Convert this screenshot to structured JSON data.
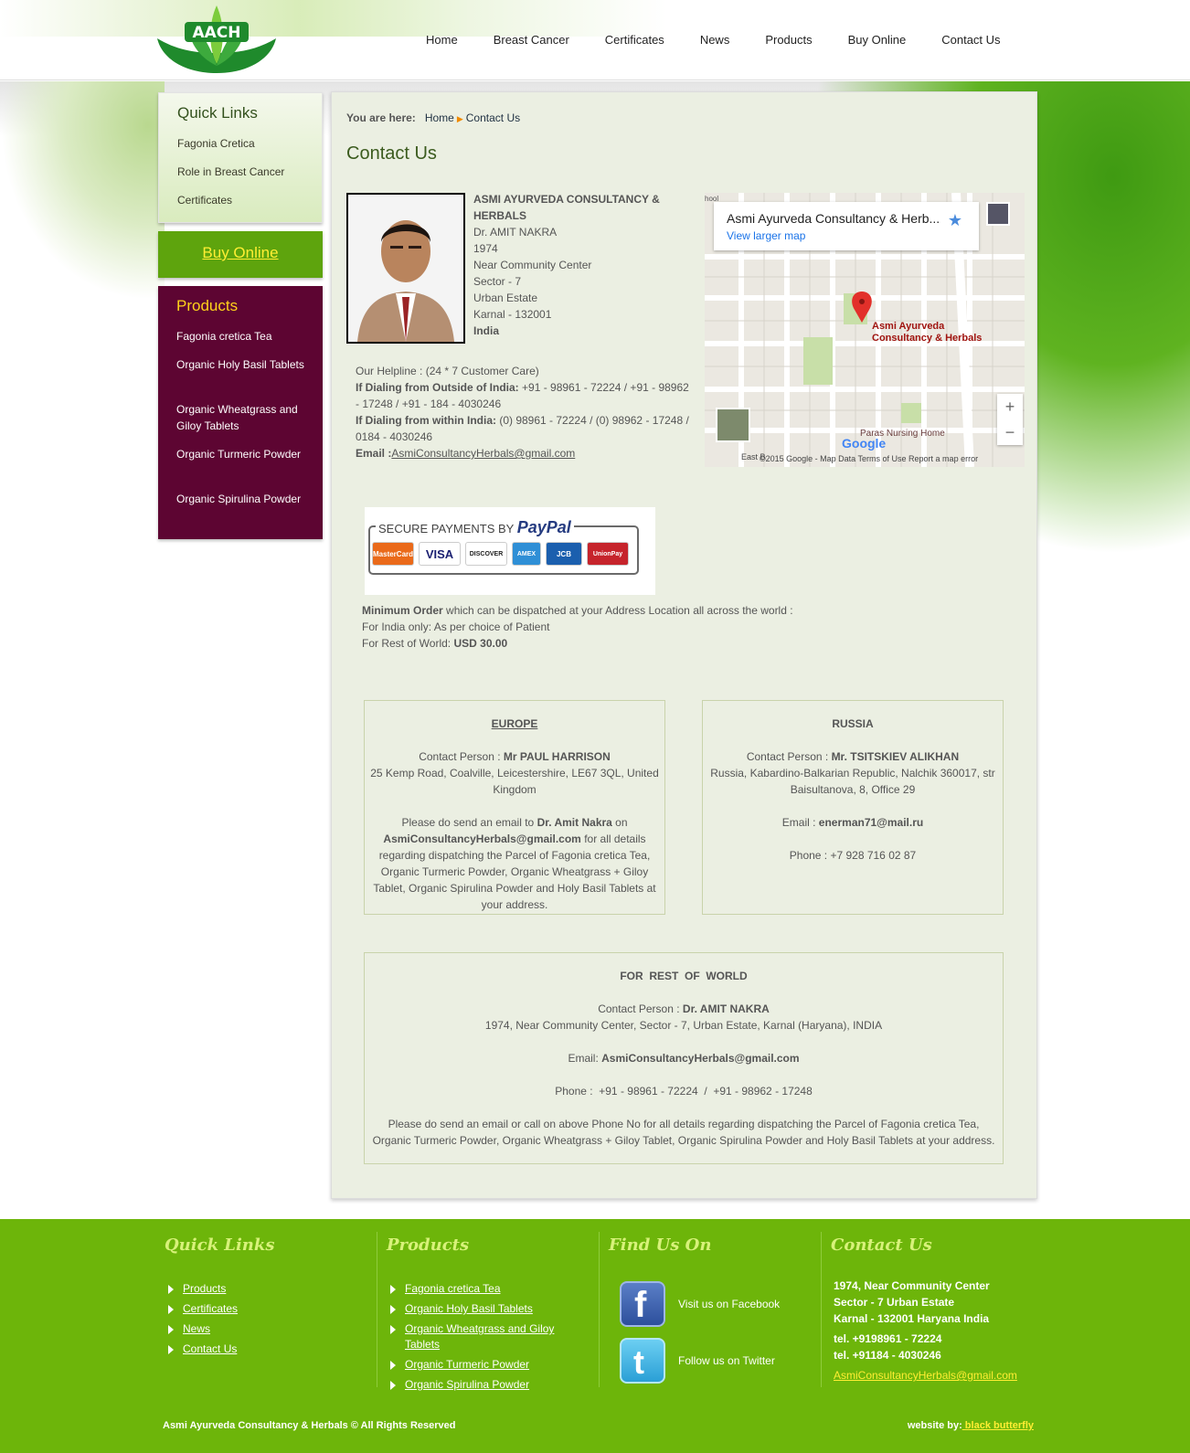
{
  "header": {
    "logo_text": "AACH",
    "nav": [
      "Home",
      "Breast Cancer",
      "Certificates",
      "News",
      "Products",
      "Buy Online",
      "Contact Us"
    ]
  },
  "sidebar": {
    "quick_links_title": "Quick Links",
    "quick_links": [
      "Fagonia Cretica",
      "Role in Breast Cancer",
      "Certificates"
    ],
    "buy_online": "Buy Online",
    "products_title": "Products",
    "products": [
      "Fagonia cretica Tea",
      "Organic Holy Basil Tablets",
      "Organic Wheatgrass and Giloy Tablets",
      "Organic Turmeric Powder",
      "Organic Spirulina Powder"
    ]
  },
  "breadcrumb": {
    "prefix": "You are here:",
    "home": "Home",
    "current": "Contact Us"
  },
  "title": "Contact Us",
  "address": {
    "company": "ASMI AYURVEDA CONSULTANCY & HERBALS",
    "lines": [
      "Dr. AMIT NAKRA",
      "1974",
      "Near Community Center",
      "Sector - 7",
      "Urban Estate",
      "Karnal - 132001"
    ],
    "country": "India"
  },
  "helpline": {
    "intro": "Our Helpline : (24 * 7 Customer Care)",
    "outside_label": "If Dialing from Outside of India:",
    "outside_numbers": " +91 - 98961 - 72224 / +91 - 98962 - 17248 / +91 - 184 - 4030246",
    "within_label": "If Dialing from within India:",
    "within_numbers": " (0) 98961 - 72224 / (0) 98962 - 17248 / 0184 - 4030246",
    "email_label": "Email :",
    "email": "AsmiConsultancyHerbals@gmail.com"
  },
  "map": {
    "place": "Asmi Ayurveda Consultancy & Herb...",
    "larger": "View larger map",
    "pin_label_1": "Asmi Ayurveda",
    "pin_label_2": "Consultancy & Herbals",
    "nursing": "Paras Nursing Home",
    "school": "hool",
    "east": "East B",
    "google": "Google",
    "footer": "©2015 Google - Map Data    Terms of Use    Report a map error",
    "zoom_in": "+",
    "zoom_out": "−"
  },
  "paypal": {
    "title_prefix": "SECURE PAYMENTS BY",
    "brand": "PayPal",
    "cards": [
      {
        "name": "MasterCard",
        "color": "#ea6a1a"
      },
      {
        "name": "VISA",
        "color": "#ffffff"
      },
      {
        "name": "DISCOVER",
        "color": "#ffffff"
      },
      {
        "name": "AMEX",
        "color": "#2f8fd6"
      },
      {
        "name": "JCB",
        "color": "#1b5fae"
      },
      {
        "name": "UnionPay",
        "color": "#c6242c"
      }
    ]
  },
  "min_order": {
    "label": "Minimum Order",
    "text": " which can be dispatched at your Address Location all across the world :",
    "india": "For India only: As per choice of Patient",
    "world_label": "For Rest of World: ",
    "world_value": "USD 30.00"
  },
  "europe": {
    "heading": "EUROPE",
    "contact_label": "Contact Person : ",
    "contact_name": "Mr PAUL HARRISON",
    "address": "25 Kemp Road, Coalville, Leicestershire, LE67 3QL, United Kingdom",
    "note_1": "Please do send an email to ",
    "note_name": "Dr. Amit Nakra",
    "note_2": " on ",
    "note_email": "AsmiConsultancyHerbals@gmail.com",
    "note_3": " for all details regarding dispatching the Parcel of Fagonia cretica Tea, Organic Turmeric Powder, Organic Wheatgrass + Giloy Tablet, Organic Spirulina Powder and Holy Basil Tablets at your address."
  },
  "russia": {
    "heading": "RUSSIA",
    "contact_label": "Contact Person : ",
    "contact_name": "Mr. TSITSKIEV ALIKHAN",
    "address": "Russia, Kabardino-Balkarian Republic, Nalchik 360017, str Baisultanova, 8, Office 29",
    "email_label": "Email : ",
    "email": "enerman71@mail.ru",
    "phone": "Phone : +7 928 716 02 87"
  },
  "world": {
    "heading": "FOR  REST  OF  WORLD",
    "contact_label": "Contact Person : ",
    "contact_name": "Dr. AMIT NAKRA",
    "address": "1974, Near Community Center, Sector - 7, Urban Estate, Karnal (Haryana), INDIA",
    "email_label": "Email: ",
    "email": "AsmiConsultancyHerbals@gmail.com",
    "phone": "Phone :  +91 - 98961 - 72224  /  +91 - 98962 - 17248",
    "note": "Please do send an email or call on above Phone No for all details regarding dispatching the Parcel of Fagonia cretica Tea, Organic Turmeric Powder, Organic Wheatgrass + Giloy Tablet, Organic Spirulina Powder and Holy Basil Tablets at your address."
  },
  "footer": {
    "quick_title": "Quick Links",
    "quick": [
      "Products",
      "Certificates",
      "News",
      "Contact Us"
    ],
    "products_title": "Products",
    "products": [
      "Fagonia cretica Tea",
      "Organic Holy Basil Tablets",
      "Organic Wheatgrass and Giloy Tablets",
      "Organic Turmeric Powder",
      "Organic Spirulina Powder"
    ],
    "find_title": "Find Us On",
    "facebook": "Visit us on Facebook",
    "twitter": "Follow us on Twitter",
    "contact_title": "Contact Us",
    "contact_lines": [
      "1974, Near Community Center",
      "Sector - 7 Urban Estate",
      "Karnal - 132001 Haryana India"
    ],
    "tel1": "tel. +9198961 - 72224",
    "tel2": "tel. +91184 - 4030246",
    "email": "AsmiConsultancyHerbals@gmail.com",
    "copyright": "Asmi Ayurveda Consultancy & Herbals © All Rights Reserved",
    "credit_label": "website by:",
    "credit_link": " black butterfly"
  }
}
